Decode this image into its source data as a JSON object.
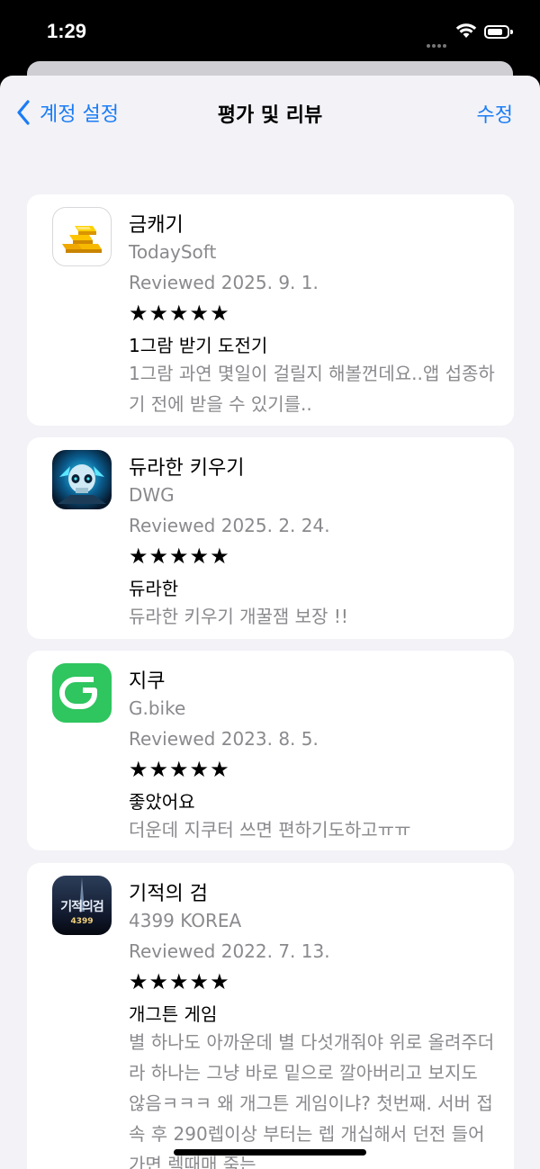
{
  "status_bar": {
    "time": "1:29"
  },
  "nav": {
    "back_label": "계정 설정",
    "title": "평가 및 리뷰",
    "edit_label": "수정"
  },
  "reviews": [
    {
      "app": "금캐기",
      "developer": "TodaySoft",
      "reviewed": "Reviewed 2025. 9. 1.",
      "stars": "★★★★★",
      "rating": 5,
      "title": "1그람 받기 도전기",
      "body": "1그람 과연 몇일이 걸릴지 해볼껀데요..앱 섭종하기 전에 받을 수 있기를.."
    },
    {
      "app": "듀라한 키우기",
      "developer": "DWG",
      "reviewed": "Reviewed 2025. 2. 24.",
      "stars": "★★★★★",
      "rating": 5,
      "title": "듀라한",
      "body": "듀라한 키우기 개꿀잼 보장 !!"
    },
    {
      "app": "지쿠",
      "developer": "G.bike",
      "reviewed": "Reviewed 2023. 8. 5.",
      "stars": "★★★★★",
      "rating": 5,
      "title": "좋았어요",
      "body": "더운데 지쿠터 쓰면 편하기도하고ㅠㅠ"
    },
    {
      "app": "기적의 검",
      "icon_text": "기적의검",
      "icon_subtext": "4399",
      "developer": "4399 KOREA",
      "reviewed": "Reviewed 2022. 7. 13.",
      "stars": "★★★★★",
      "rating": 5,
      "title": "개그튼 게임",
      "body": "별 하나도 아까운데 별 다섯개줘야 위로 올려주더라 하나는 그냥 바로 밑으로 깔아버리고 보지도 않음ㅋㅋㅋ 왜 개그튼 게임이냐? 첫번째. 서버 접속 후 290렙이상 부터는 렙 개십해서 던전 들어가면 렉때매 죽는"
    }
  ],
  "colors": {
    "accent": "#1a7cf5",
    "background": "#f2f2f7",
    "secondary_text": "#8a8a8e"
  },
  "icons": [
    "chevron-left-icon",
    "wifi-icon",
    "battery-icon",
    "gold-bars-icon",
    "skull-knight-icon",
    "gbike-logo-icon",
    "sword-game-icon"
  ]
}
